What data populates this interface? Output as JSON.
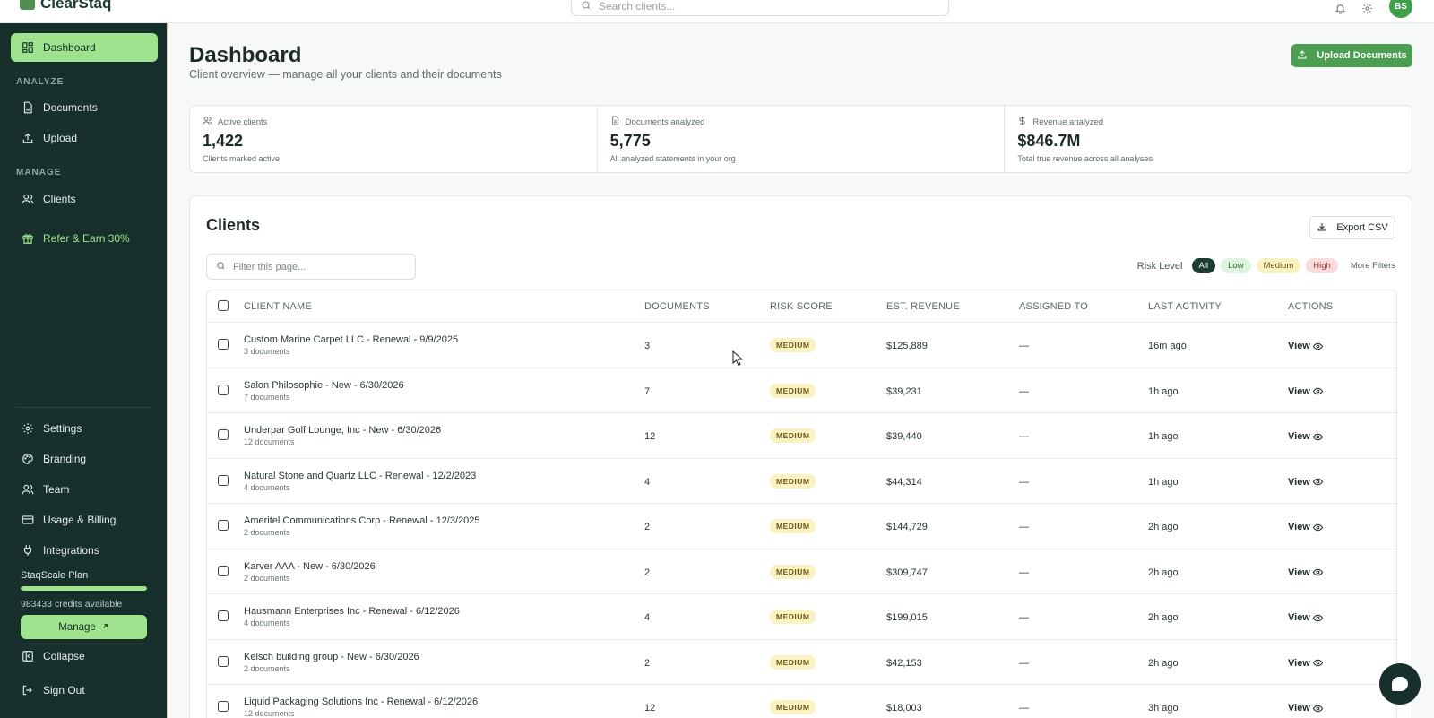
{
  "app": {
    "name": "ClearStaq"
  },
  "topbar": {
    "search_placeholder": "Search clients...",
    "avatar_initials": "BS"
  },
  "sidebar": {
    "dashboard": "Dashboard",
    "section_analyze": "ANALYZE",
    "documents": "Documents",
    "upload": "Upload",
    "section_manage": "MANAGE",
    "clients": "Clients",
    "refer": "Refer & Earn 30%",
    "settings": "Settings",
    "branding": "Branding",
    "team": "Team",
    "billing": "Usage & Billing",
    "integrations": "Integrations",
    "plan_name": "StaqScale Plan",
    "plan_usage_fraction": 1.0,
    "plan_credits": "983433 credits available",
    "manage_label": "Manage",
    "collapse": "Collapse",
    "sign_out": "Sign Out"
  },
  "header": {
    "title": "Dashboard",
    "subtitle": "Client overview — manage all your clients and their documents",
    "upload_label": "Upload Documents"
  },
  "stats": [
    {
      "label": "Active clients",
      "value": "1,422",
      "desc": "Clients marked active"
    },
    {
      "label": "Documents analyzed",
      "value": "5,775",
      "desc": "All analyzed statements in your org"
    },
    {
      "label": "Revenue analyzed",
      "value": "$846.7M",
      "desc": "Total true revenue across all analyses"
    }
  ],
  "clients": {
    "title": "Clients",
    "export_label": "Export CSV",
    "filter_placeholder": "Filter this page...",
    "risk_label": "Risk Level",
    "risk_all": "All",
    "risk_low": "Low",
    "risk_medium": "Medium",
    "risk_high": "High",
    "more_filters": "More Filters",
    "columns": {
      "name": "CLIENT NAME",
      "documents": "DOCUMENTS",
      "risk": "RISK SCORE",
      "revenue": "EST. REVENUE",
      "assigned": "ASSIGNED TO",
      "activity": "LAST ACTIVITY",
      "actions": "ACTIONS"
    },
    "rows": [
      {
        "name": "Custom Marine Carpet LLC - Renewal - 9/9/2025",
        "sub": "3 documents",
        "docs": "3",
        "risk": "MEDIUM",
        "revenue": "$125,889",
        "assigned": "—",
        "activity": "16m ago",
        "action": "View"
      },
      {
        "name": "Salon Philosophie - New - 6/30/2026",
        "sub": "7 documents",
        "docs": "7",
        "risk": "MEDIUM",
        "revenue": "$39,231",
        "assigned": "—",
        "activity": "1h ago",
        "action": "View"
      },
      {
        "name": "Underpar Golf Lounge, Inc - New - 6/30/2026",
        "sub": "12 documents",
        "docs": "12",
        "risk": "MEDIUM",
        "revenue": "$39,440",
        "assigned": "—",
        "activity": "1h ago",
        "action": "View"
      },
      {
        "name": "Natural Stone and Quartz LLC - Renewal - 12/2/2023",
        "sub": "4 documents",
        "docs": "4",
        "risk": "MEDIUM",
        "revenue": "$44,314",
        "assigned": "—",
        "activity": "1h ago",
        "action": "View"
      },
      {
        "name": "Ameritel Communications Corp - Renewal - 12/3/2025",
        "sub": "2 documents",
        "docs": "2",
        "risk": "MEDIUM",
        "revenue": "$144,729",
        "assigned": "—",
        "activity": "2h ago",
        "action": "View"
      },
      {
        "name": "Karver AAA - New - 6/30/2026",
        "sub": "2 documents",
        "docs": "2",
        "risk": "MEDIUM",
        "revenue": "$309,747",
        "assigned": "—",
        "activity": "2h ago",
        "action": "View"
      },
      {
        "name": "Hausmann Enterprises Inc - Renewal - 6/12/2026",
        "sub": "4 documents",
        "docs": "4",
        "risk": "MEDIUM",
        "revenue": "$199,015",
        "assigned": "—",
        "activity": "2h ago",
        "action": "View"
      },
      {
        "name": "Kelsch building group - New - 6/30/2026",
        "sub": "2 documents",
        "docs": "2",
        "risk": "MEDIUM",
        "revenue": "$42,153",
        "assigned": "—",
        "activity": "2h ago",
        "action": "View"
      },
      {
        "name": "Liquid Packaging Solutions Inc - Renewal - 6/12/2026",
        "sub": "12 documents",
        "docs": "12",
        "risk": "MEDIUM",
        "revenue": "$18,003",
        "assigned": "—",
        "activity": "3h ago",
        "action": "View"
      }
    ]
  },
  "colors": {
    "sidebar_bg": "#17302c",
    "accent_green": "#9fe38e",
    "primary_button": "#4c9f50",
    "medium_badge": "#fbf2c4"
  }
}
